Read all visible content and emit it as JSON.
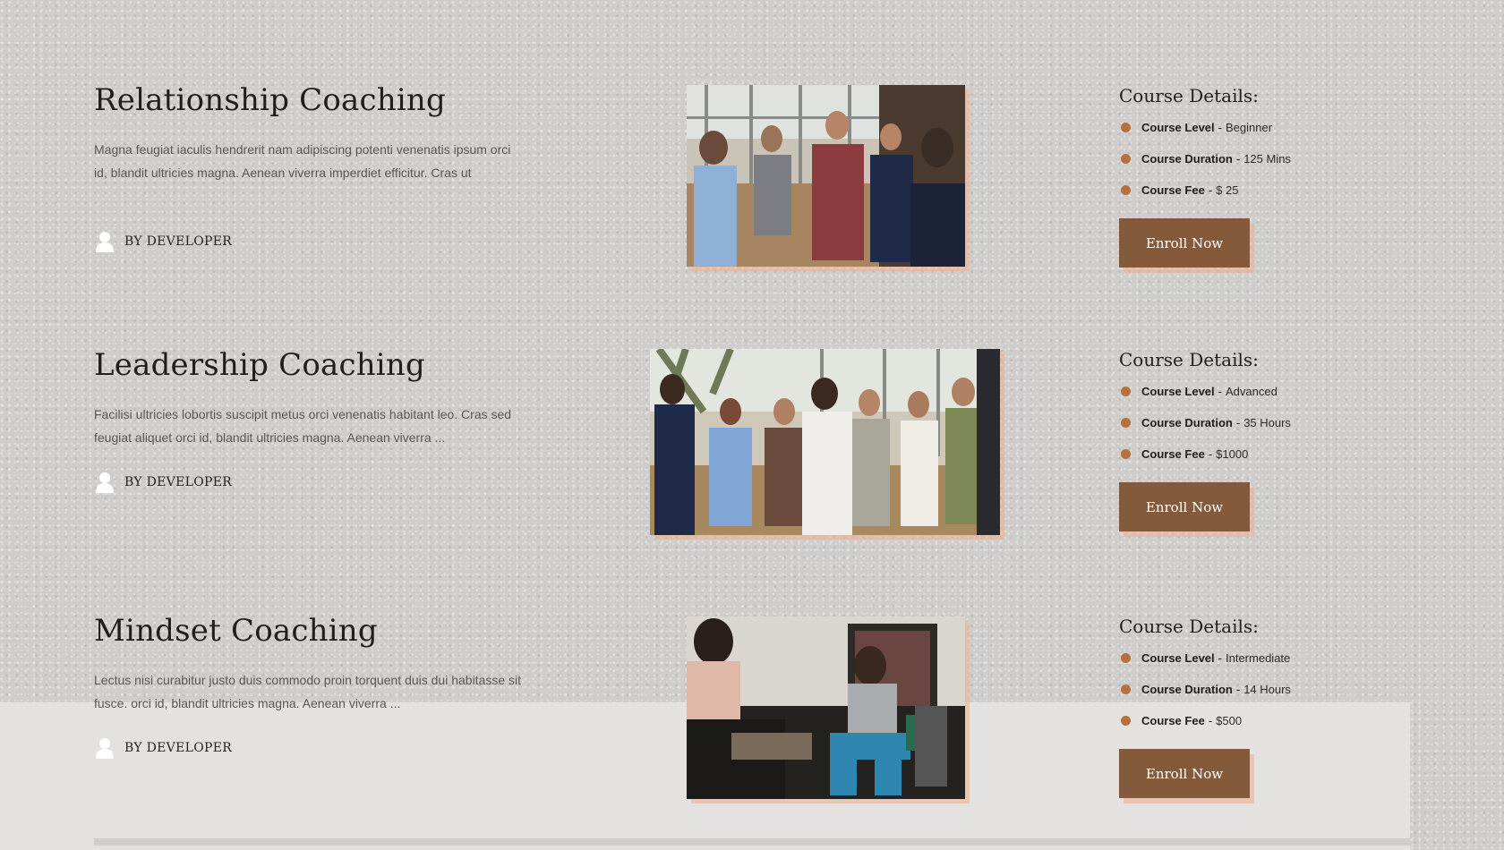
{
  "courses": [
    {
      "title": "Relationship Coaching",
      "description": "Magna feugiat iaculis hendrerit nam adipiscing potenti venenatis ipsum orci id, blandit ultricies magna. Aenean viverra imperdiet efficitur. Cras ut",
      "author": "BY DEVELOPER",
      "details_heading": "Course Details:",
      "details": [
        {
          "key": "Course Level",
          "value": "Beginner"
        },
        {
          "key": "Course Duration",
          "value": "125 Mins"
        },
        {
          "key": "Course Fee",
          "value": "$ 25"
        }
      ],
      "button": "Enroll Now"
    },
    {
      "title": "Leadership Coaching",
      "description": "Facilisi ultricies lobortis suscipit metus orci venenatis habitant leo. Cras sed feugiat aliquet orci id, blandit ultricies magna. Aenean viverra ...",
      "author": "BY DEVELOPER",
      "details_heading": "Course Details:",
      "details": [
        {
          "key": "Course Level",
          "value": "Advanced"
        },
        {
          "key": "Course Duration",
          "value": "35 Hours"
        },
        {
          "key": "Course Fee",
          "value": "$1000"
        }
      ],
      "button": "Enroll Now"
    },
    {
      "title": "Mindset Coaching",
      "description": "Lectus nisi curabitur justo duis commodo proin torquent duis dui habitasse sit fusce. orci id, blandit ultricies magna. Aenean viverra ...",
      "author": "BY DEVELOPER",
      "details_heading": "Course Details:",
      "details": [
        {
          "key": "Course Level",
          "value": "Intermediate"
        },
        {
          "key": "Course Duration",
          "value": "14 Hours"
        },
        {
          "key": "Course Fee",
          "value": "$500"
        }
      ],
      "button": "Enroll Now"
    }
  ],
  "separator": "-",
  "icons": {
    "author": "user-icon",
    "bullet": "dot-icon"
  },
  "colors": {
    "button_bg": "#855a3b",
    "bullet": "#b5703e",
    "accent_shadow": "#f0af8c"
  }
}
